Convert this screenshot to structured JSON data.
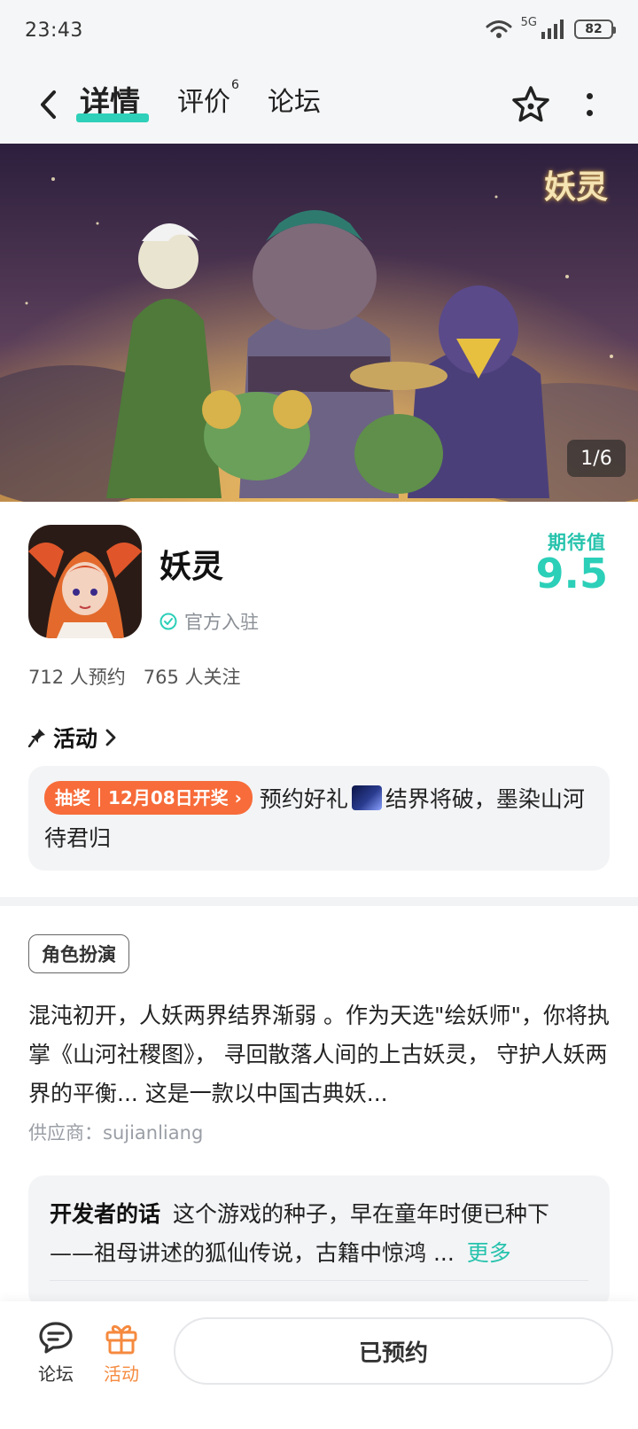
{
  "status_bar": {
    "time": "23:43",
    "network": "5G",
    "battery": "82"
  },
  "nav": {
    "tabs": [
      {
        "label": "详情",
        "badge": ""
      },
      {
        "label": "评价",
        "badge": "6"
      },
      {
        "label": "论坛",
        "badge": ""
      }
    ],
    "accent_color": "#2ed0b9"
  },
  "banner": {
    "logo_text": "妖灵",
    "counter": "1/6"
  },
  "game": {
    "name": "妖灵",
    "official_label": "官方入驻",
    "expectation_label": "期待值",
    "expectation_value": "9.5",
    "reservations": "712 人预约",
    "followers": "765 人关注"
  },
  "activity": {
    "heading": "活动",
    "tag": "抽奖｜12月08日开奖",
    "text_before": "预约好礼",
    "text_after": "结界将破，墨染山河待君归"
  },
  "genre_tag": "角色扮演",
  "description": "混沌初开，人妖两界结界渐弱 。作为天选\"绘妖师\"，你将执掌《山河社稷图》， 寻回散落人间的上古妖灵， 守护人妖两界的平衡... 这是一款以中国古典妖...",
  "supplier": "供应商：sujianliang",
  "developer": {
    "title": "开发者的话",
    "text": "这个游戏的种子，早在童年时便已种下——祖母讲述的狐仙传说，古籍中惊鸿 ...",
    "more": "更多"
  },
  "bottom_bar": {
    "forum_label": "论坛",
    "activity_label": "活动",
    "reserve_button": "已预约",
    "activity_color": "#f58a3f"
  }
}
